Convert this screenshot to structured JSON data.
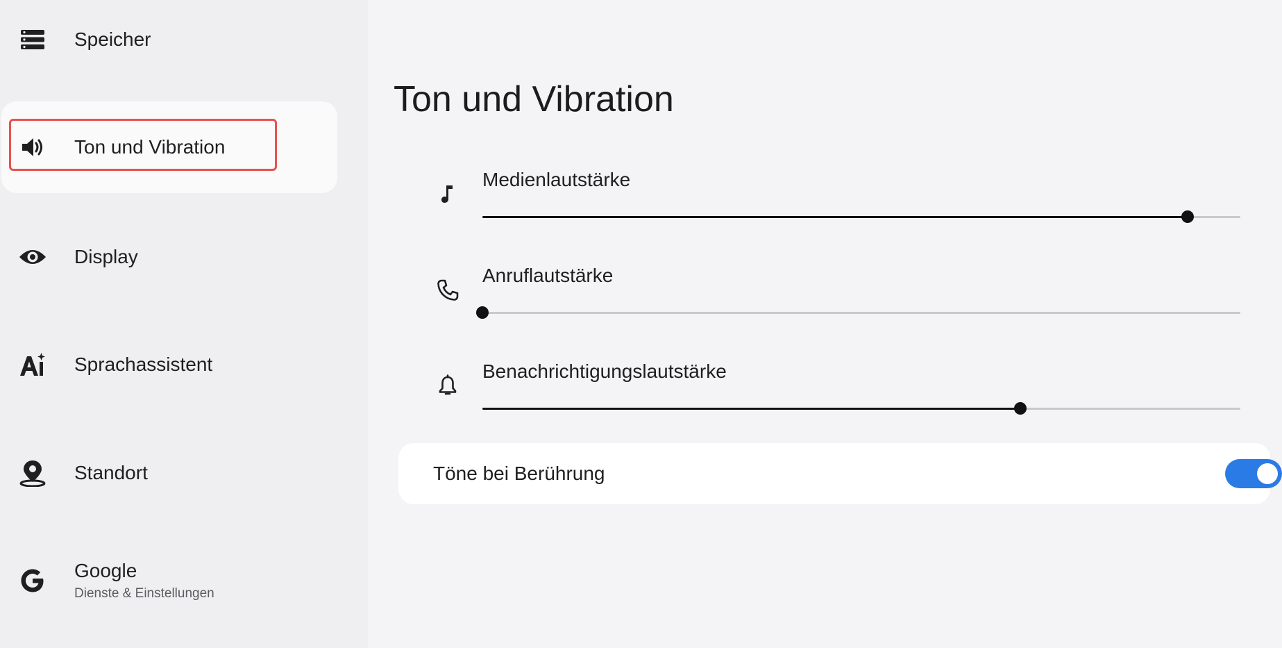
{
  "sidebar": {
    "items": [
      {
        "label": "Speicher",
        "icon": "storage-icon"
      },
      {
        "label": "Ton und Vibration",
        "icon": "volume-icon",
        "selected": true
      },
      {
        "label": "Display",
        "icon": "eye-icon"
      },
      {
        "label": "Sprachassistent",
        "icon": "ai-assistant-icon"
      },
      {
        "label": "Standort",
        "icon": "location-pin-icon"
      },
      {
        "label": "Google",
        "sub": "Dienste & Einstellungen",
        "icon": "google-icon"
      }
    ]
  },
  "main": {
    "title": "Ton und Vibration",
    "sliders": [
      {
        "label": "Medienlautstärke",
        "icon": "music-note-icon",
        "value_percent": 93
      },
      {
        "label": "Anruflautstärke",
        "icon": "phone-icon",
        "value_percent": 0
      },
      {
        "label": "Benachrichtigungslautstärke",
        "icon": "bell-icon",
        "value_percent": 71
      }
    ],
    "toggle": {
      "label": "Töne bei Berührung",
      "checked": true
    }
  },
  "colors": {
    "accent": "#2b7be6",
    "highlight": "#e8514f",
    "slider_active": "#111111",
    "slider_inactive": "#c9c9cc"
  }
}
